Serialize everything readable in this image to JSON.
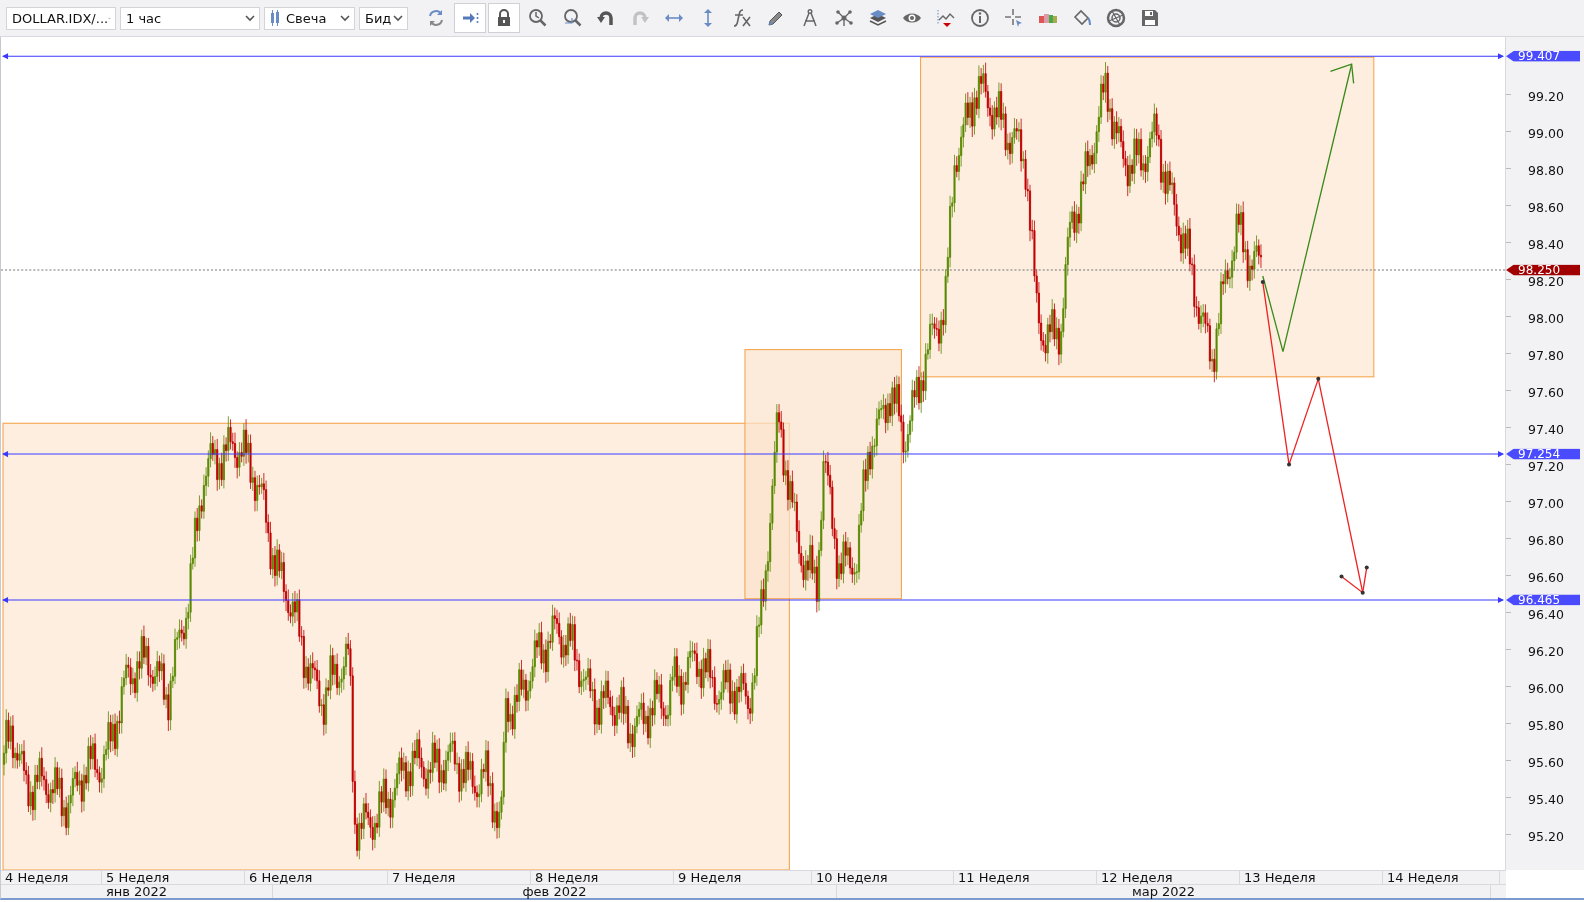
{
  "toolbar": {
    "symbol": "DOLLAR.IDX/...",
    "timeframe": "1 час",
    "chart_type": "Свеча",
    "price_type": "Бид",
    "tools": [
      {
        "kind": "refresh",
        "pressed": false,
        "disabled": false
      },
      {
        "kind": "autoscroll",
        "pressed": true,
        "disabled": false
      },
      {
        "kind": "lock",
        "pressed": true,
        "disabled": false
      },
      {
        "kind": "zoomtime",
        "pressed": false,
        "disabled": false
      },
      {
        "kind": "zoomarea",
        "pressed": false,
        "disabled": false
      },
      {
        "kind": "undo",
        "pressed": false,
        "disabled": false
      },
      {
        "kind": "redo",
        "pressed": false,
        "disabled": true
      },
      {
        "kind": "hfit",
        "pressed": false,
        "disabled": false
      },
      {
        "kind": "vfit",
        "pressed": false,
        "disabled": false
      },
      {
        "kind": "fx",
        "pressed": false,
        "disabled": false
      },
      {
        "kind": "pencil",
        "pressed": false,
        "disabled": false
      },
      {
        "kind": "compass",
        "pressed": false,
        "disabled": false
      },
      {
        "kind": "network",
        "pressed": false,
        "disabled": false
      },
      {
        "kind": "layers",
        "pressed": false,
        "disabled": false
      },
      {
        "kind": "eye",
        "pressed": false,
        "disabled": false
      },
      {
        "kind": "marker",
        "pressed": false,
        "disabled": false
      },
      {
        "kind": "info",
        "pressed": false,
        "disabled": false
      },
      {
        "kind": "crosshair",
        "pressed": false,
        "disabled": false
      },
      {
        "kind": "colors",
        "pressed": false,
        "disabled": false
      },
      {
        "kind": "bucket",
        "pressed": false,
        "disabled": false
      },
      {
        "kind": "aperture",
        "pressed": false,
        "disabled": false
      },
      {
        "kind": "save",
        "pressed": false,
        "disabled": false
      }
    ]
  },
  "price_axis": {
    "ticks": [
      "99.20",
      "99.00",
      "98.80",
      "98.60",
      "98.40",
      "98.20",
      "98.00",
      "97.80",
      "97.60",
      "97.40",
      "97.20",
      "97.00",
      "96.80",
      "96.60",
      "96.40",
      "96.20",
      "96.00",
      "95.80",
      "95.60",
      "95.40",
      "95.20"
    ]
  },
  "levels": [
    {
      "kind": "line",
      "label": "99.407"
    },
    {
      "kind": "current",
      "label": "98.250"
    },
    {
      "kind": "line",
      "label": "97.254"
    },
    {
      "kind": "line",
      "label": "96.465"
    }
  ],
  "time_axis": {
    "weeks": [
      "4 Неделя",
      "5 Неделя",
      "6 Неделя",
      "7 Неделя",
      "8 Неделя",
      "9 Неделя",
      "10 Неделя",
      "11 Неделя",
      "12 Неделя",
      "13 Неделя",
      "14 Неделя"
    ],
    "months": [
      "янв 2022",
      "фев 2022",
      "мар 2022"
    ]
  }
}
